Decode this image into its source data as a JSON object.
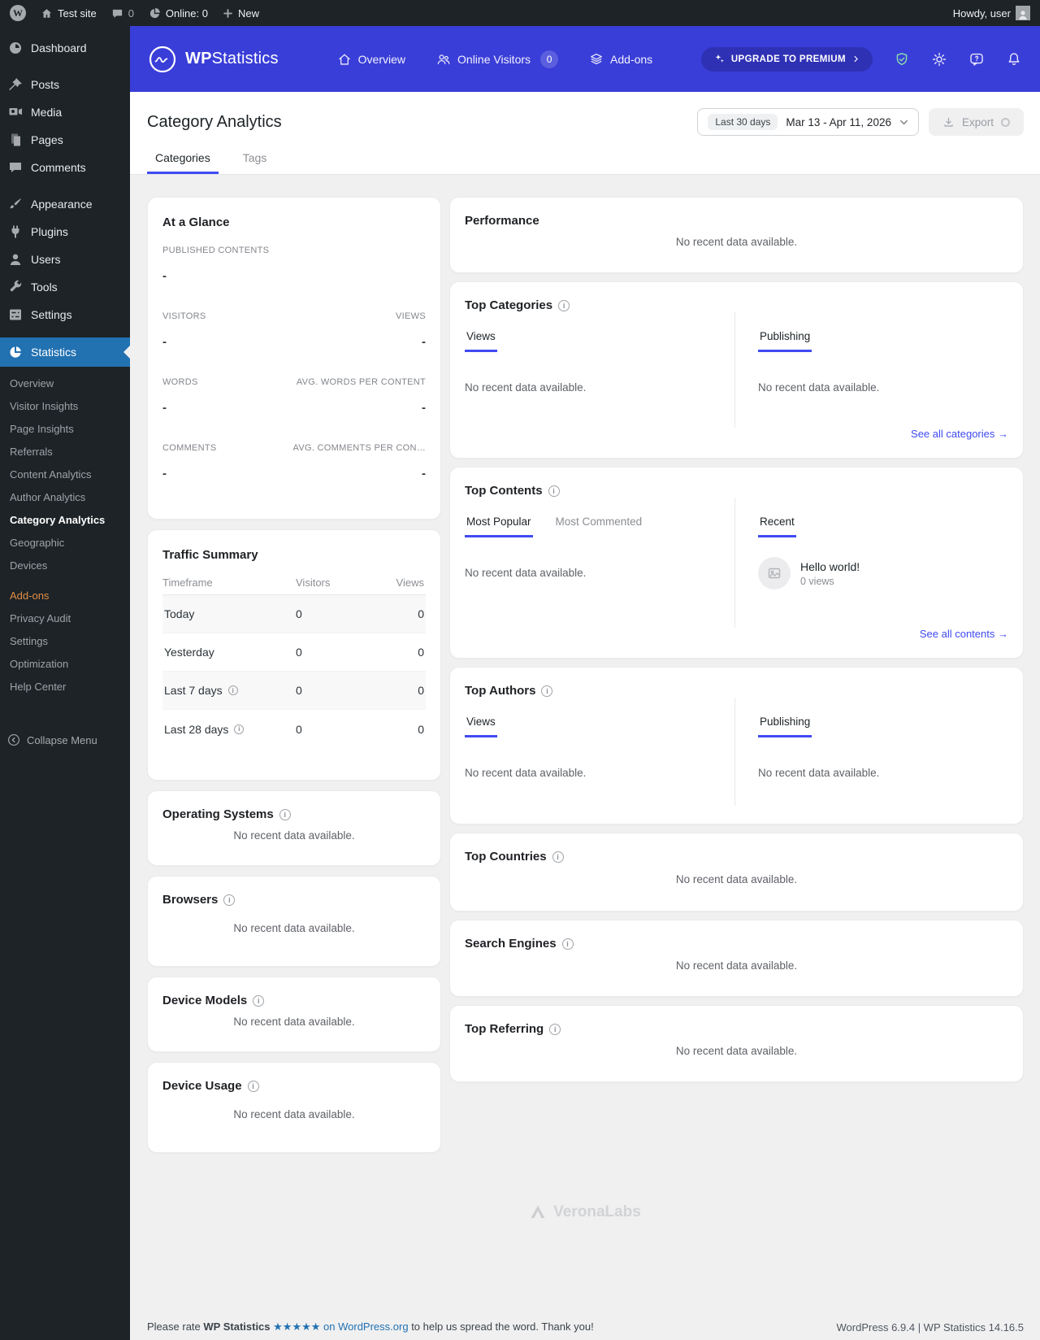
{
  "admin_bar": {
    "site_name": "Test site",
    "comment_count": "0",
    "online": "Online: 0",
    "new_label": "New",
    "howdy": "Howdy, user"
  },
  "sidebar": {
    "items": [
      "Dashboard",
      "Posts",
      "Media",
      "Pages",
      "Comments",
      "Appearance",
      "Plugins",
      "Users",
      "Tools",
      "Settings",
      "Statistics"
    ],
    "submenu": [
      "Overview",
      "Visitor Insights",
      "Page Insights",
      "Referrals",
      "Content Analytics",
      "Author Analytics",
      "Category Analytics",
      "Geographic",
      "Devices",
      "Add-ons",
      "Privacy Audit",
      "Settings",
      "Optimization",
      "Help Center"
    ],
    "collapse": "Collapse Menu"
  },
  "topbar": {
    "brand_bold": "WP",
    "brand_light": "Statistics",
    "nav_overview": "Overview",
    "nav_online": "Online Visitors",
    "online_badge": "0",
    "nav_addons": "Add-ons",
    "upgrade": "UPGRADE TO PREMIUM"
  },
  "page": {
    "title": "Category Analytics",
    "tab_categories": "Categories",
    "tab_tags": "Tags",
    "date_preset": "Last 30 days",
    "date_range": "Mar 13 - Apr 11, 2026",
    "export": "Export"
  },
  "common": {
    "no_data": "No recent data available."
  },
  "glance": {
    "title": "At a Glance",
    "rows": [
      {
        "label": "PUBLISHED CONTENTS",
        "value": "-"
      },
      {
        "label": "VISITORS",
        "value": "-",
        "label2": "VIEWS",
        "value2": "-"
      },
      {
        "label": "WORDS",
        "value": "-",
        "label2": "AVG. WORDS PER CONTENT",
        "value2": "-"
      },
      {
        "label": "COMMENTS",
        "value": "-",
        "label2": "AVG. COMMENTS PER CON…",
        "value2": "-"
      }
    ]
  },
  "traffic": {
    "title": "Traffic Summary",
    "headers": [
      "Timeframe",
      "Visitors",
      "Views"
    ],
    "rows": [
      {
        "label": "Today",
        "visitors": "0",
        "views": "0"
      },
      {
        "label": "Yesterday",
        "visitors": "0",
        "views": "0"
      },
      {
        "label": "Last 7 days",
        "visitors": "0",
        "views": "0"
      },
      {
        "label": "Last 28 days",
        "visitors": "0",
        "views": "0"
      }
    ]
  },
  "left_cards": [
    {
      "title": "Operating Systems"
    },
    {
      "title": "Browsers"
    },
    {
      "title": "Device Models"
    },
    {
      "title": "Device Usage"
    }
  ],
  "performance": {
    "title": "Performance"
  },
  "top_categories": {
    "title": "Top Categories",
    "tab_views": "Views",
    "tab_publishing": "Publishing",
    "see_all": "See all categories",
    "arrow": "→"
  },
  "top_contents": {
    "title": "Top Contents",
    "tab_popular": "Most Popular",
    "tab_commented": "Most Commented",
    "tab_recent": "Recent",
    "item_title": "Hello world!",
    "item_meta": "0 views",
    "see_all": "See all contents",
    "arrow": "→"
  },
  "top_authors": {
    "title": "Top Authors",
    "tab_views": "Views",
    "tab_publishing": "Publishing"
  },
  "top_countries": {
    "title": "Top Countries"
  },
  "search_engines": {
    "title": "Search Engines"
  },
  "top_referring": {
    "title": "Top Referring"
  },
  "watermark": "VeronaLabs",
  "footer": {
    "rate_prefix": "Please rate",
    "rate_product": "WP Statistics",
    "rate_link": "★★★★★ on WordPress.org",
    "rate_suffix": "to help us spread the word. Thank you!",
    "versions": "WordPress 6.9.4 | WP Statistics 14.16.5"
  },
  "colors": {
    "accent": "#404BF2",
    "header_purple": "#3A3ED8",
    "admin_dark": "#1d2327",
    "menu_highlight": "#2271b1",
    "addon_orange": "#E28E44",
    "footer_link": "#2271b1"
  }
}
